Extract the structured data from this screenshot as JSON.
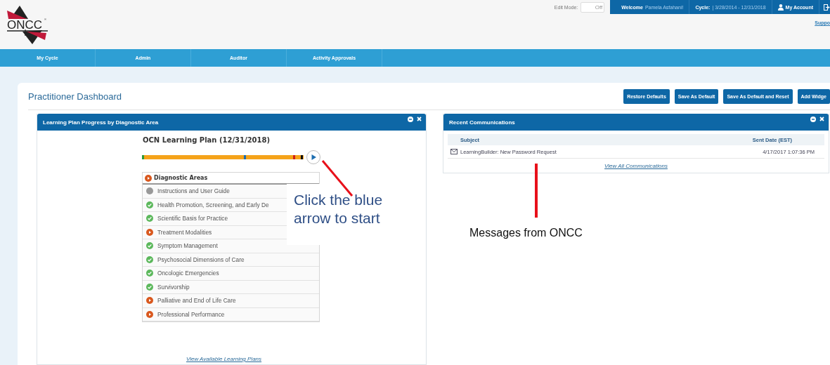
{
  "logo": {
    "text": "ONCC",
    "mark": "®"
  },
  "edit_mode": {
    "label": "Edit Mode:",
    "on": false,
    "state_label": "Off"
  },
  "user_bar": {
    "welcome": "Welcome",
    "user": "Pamela Asfahani!",
    "cycle_label": "Cycle:",
    "cycle_range": "| 3/28/2014 - 12/31/2018",
    "account": "My Account"
  },
  "support_link": "Suppo",
  "nav": [
    {
      "label": "My Cycle"
    },
    {
      "label": "Admin"
    },
    {
      "label": "Auditor"
    },
    {
      "label": "Activity Approvals"
    }
  ],
  "page_title": "Practitioner Dashboard",
  "buttons": [
    "Restore Defaults",
    "Save As Default",
    "Save As Default and Reset",
    "Add Widge"
  ],
  "widgets": [
    {
      "kind": "learning_plan",
      "title": "Learning Plan Progress by Diagnostic Area",
      "plan_title": "OCN Learning Plan (12/31/2018)",
      "progress": {
        "level": 1
      },
      "list_header": {
        "label": "Diagnostic Areas",
        "kind": "in_progress"
      },
      "areas": [
        {
          "label": "Instructions and User Guide",
          "kind": "not_started"
        },
        {
          "label": "Health Promotion, Screening, and Early De",
          "kind": "complete"
        },
        {
          "label": "Scientific Basis for Practice",
          "kind": "complete"
        },
        {
          "label": "Treatment Modalities",
          "kind": "in_progress"
        },
        {
          "label": "Symptom Management",
          "kind": "complete"
        },
        {
          "label": "Psychosocial Dimensions of Care",
          "kind": "complete"
        },
        {
          "label": "Oncologic Emergencies",
          "kind": "complete"
        },
        {
          "label": "Survivorship",
          "kind": "complete"
        },
        {
          "label": "Palliative and End of Life Care",
          "kind": "in_progress"
        },
        {
          "label": "Professional Performance",
          "kind": "in_progress"
        }
      ],
      "link": "View Available Learning Plans"
    },
    {
      "kind": "communications",
      "title": "Recent Communications",
      "columns": [
        "Subject",
        "Sent Date (EST)"
      ],
      "rows": [
        {
          "subject": "LearningBuilder: New Password Request",
          "sent": "4/17/2017 1:07:36 PM"
        }
      ],
      "link": "View All Communications"
    }
  ],
  "callouts": [
    {
      "text": "Click the blue arrow to start"
    },
    {
      "text": "Messages from ONCC"
    }
  ]
}
